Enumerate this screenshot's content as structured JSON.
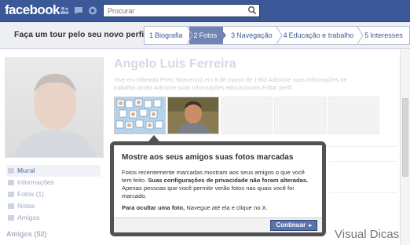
{
  "topbar": {
    "logo": "facebook",
    "search_placeholder": "Procurar",
    "jewels": [
      "friend-requests-icon",
      "messages-icon",
      "notifications-icon"
    ]
  },
  "tour": {
    "title": "Faça um tour pelo seu novo perfil",
    "steps": [
      {
        "num": "1",
        "label": "Biografia",
        "active": false
      },
      {
        "num": "2",
        "label": "Fotos",
        "active": true
      },
      {
        "num": "3",
        "label": "Navegação",
        "active": false
      },
      {
        "num": "4",
        "label": "Educação e trabalho",
        "active": false
      },
      {
        "num": "5",
        "label": "Interesses",
        "active": false
      }
    ]
  },
  "profile": {
    "name": "Angelo Luis Ferreira",
    "meta_line1": "Vive em Ribeirão Preto    Nasceu(a) em 8 de março de 1962    Adicione suas informações de",
    "meta_line2": "trabalho atuais    Adicione suas informações educacionais    Editar perfil"
  },
  "left_nav": {
    "items": [
      {
        "label": "Mural",
        "selected": true
      },
      {
        "label": "Informações",
        "selected": false
      },
      {
        "label": "Fotos (1)",
        "selected": false
      },
      {
        "label": "Notas",
        "selected": false
      },
      {
        "label": "Amigos",
        "selected": false
      }
    ],
    "friends_title": "Amigos (52)"
  },
  "dialog": {
    "title": "Mostre aos seus amigos suas fotos marcadas",
    "body_part1": "Fotos recentemente marcadas mostram aos seus amigos o que você tem feito.",
    "body_bold1": "Suas configurações de privacidade não foram alteradas.",
    "body_part2": "Apenas pessoas que você permitir verão fotos nas quais você foi marcado.",
    "body_bold2": "Para ocultar uma foto,",
    "body_part3": "Navegue até ela e clique no X.",
    "continue_label": "Continuar"
  },
  "watermark": "Visual Dicas",
  "colors": {
    "brand": "#3b5998",
    "tour_bg": "#edeff4",
    "active_step": "#6d84b4",
    "dialog_border": "#525252",
    "button": "#5b74a8"
  }
}
